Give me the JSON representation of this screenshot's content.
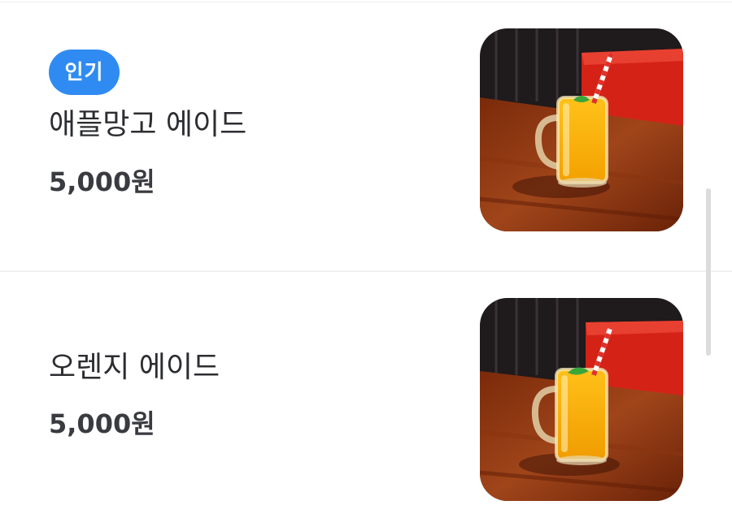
{
  "menu_items": [
    {
      "badge": "인기",
      "name": "애플망고 에이드",
      "price": "5,000원",
      "image": "drink-photo"
    },
    {
      "badge": "",
      "name": "오렌지 에이드",
      "price": "5,000원",
      "image": "drink-photo"
    }
  ],
  "colors": {
    "badge_bg": "#2f8bf2",
    "text_primary": "#2c2d31",
    "price_text": "#3a3b40"
  }
}
